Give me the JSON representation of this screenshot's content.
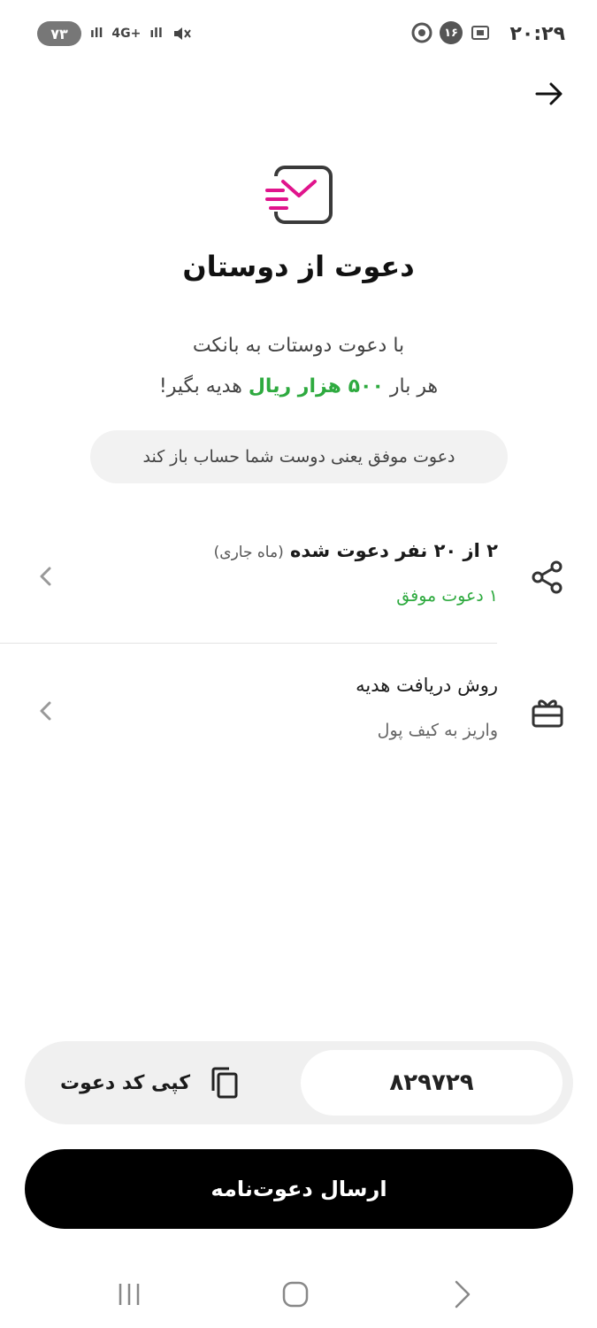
{
  "status_bar": {
    "time": "۲۰:۲۹",
    "notification_count": "۱۶",
    "battery": "۷۳",
    "network": "4G+"
  },
  "header": {
    "title": "دعوت از دوستان",
    "subtitle_line1": "با دعوت دوستات به بانکت",
    "subtitle_line2_prefix": "هر بار",
    "subtitle_line2_highlight": "۵۰۰ هزار ریال",
    "subtitle_line2_suffix": "هدیه بگیر!",
    "highlight_color": "#2eaa3f"
  },
  "info_pill": "دعوت موفق یعنی دوست شما حساب باز کند",
  "invites_row": {
    "title": "۲ از ۲۰ نفر دعوت شده",
    "title_note": "(ماه جاری)",
    "subtitle": "۱ دعوت موفق",
    "icon": "share-icon"
  },
  "gift_row": {
    "title": "روش دریافت هدیه",
    "subtitle": "واریز به کیف پول",
    "icon": "gift-icon"
  },
  "invite_code": {
    "code": "۸۲۹۷۲۹",
    "copy_label": "کپی کد دعوت",
    "icon": "copy-icon"
  },
  "send_button": "ارسال دعوت‌نامه",
  "nav": {
    "recent": "recent-apps-icon",
    "home": "home-icon",
    "back": "back-icon"
  }
}
